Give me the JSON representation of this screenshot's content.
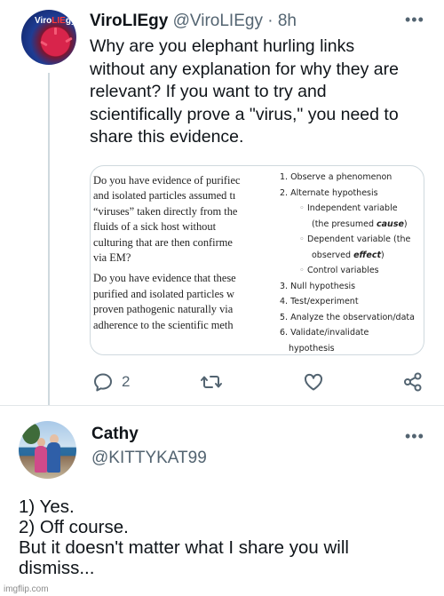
{
  "tweet": {
    "author": {
      "display_name": "ViroLIEgy",
      "handle": "@ViroLIEgy",
      "separator": " · ",
      "time": "8h",
      "avatar_text_a": "Viro",
      "avatar_text_b": "LIE",
      "avatar_text_c": "gy"
    },
    "text_lines": [
      "Why are you elephant hurling links",
      "without any explanation for why they are",
      "relevant? If you want to try and",
      "scientifically prove a \"virus,\" you need to",
      "share this evidence."
    ],
    "media": {
      "left_paragraph_1": [
        "Do you have evidence of purifiec",
        "and isolated particles assumed tı",
        "“viruses” taken directly from the",
        "fluids of a sick host without",
        "culturing that are then confirme",
        "via EM?"
      ],
      "left_paragraph_2": [
        "Do you have evidence that these",
        "purified and isolated particles w",
        "proven pathogenic naturally via",
        "adherence to the scientific meth"
      ],
      "steps": {
        "s1": "1. Observe a phenomenon",
        "s2": "2. Alternate hypothesis",
        "iv_a": "Independent variable",
        "iv_b_pre": "(the presumed ",
        "iv_b_em": "cause",
        "iv_b_post": ")",
        "dv_a": "Dependent variable (the",
        "dv_b_pre": "observed ",
        "dv_b_em": "effect",
        "dv_b_post": ")",
        "cv": "Control variables",
        "s3": "3. Null hypothesis",
        "s4": "4. Test/experiment",
        "s5": "5. Analyze the observation/data",
        "s6": "6. Validate/invalidate",
        "s6b": "hypothesis"
      }
    },
    "actions": {
      "reply_count": "2"
    }
  },
  "reply": {
    "display_name": "Cathy",
    "handle": "@KITTYKAT99",
    "text_lines": [
      "1) Yes.",
      "2) Off course.",
      "But it doesn't matter what I share you will",
      "dismiss..."
    ]
  },
  "watermark": "imgflip.com",
  "icons": {
    "more": "more-icon",
    "reply": "reply-icon",
    "retweet": "retweet-icon",
    "like": "like-icon",
    "share": "share-icon"
  },
  "colors": {
    "text": "#0f1419",
    "secondary": "#536471",
    "border": "#cfd9de"
  }
}
